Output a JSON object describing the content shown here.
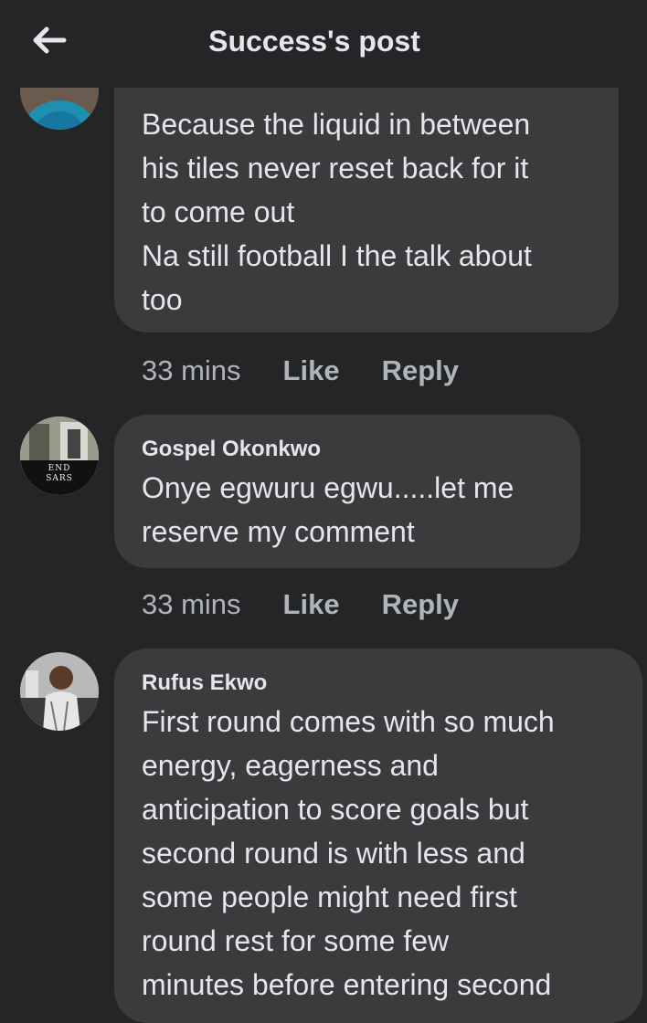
{
  "header": {
    "title": "Success's post"
  },
  "comments": [
    {
      "author": "",
      "text": "Because the liquid in between\nhis tiles never reset back for it\nto come out\nNa still football I the talk about\ntoo",
      "time": "33 mins",
      "like": "Like",
      "reply": "Reply"
    },
    {
      "author": "Gospel Okonkwo",
      "text": "Onye egwuru egwu.....let me\nreserve my comment",
      "time": "33 mins",
      "like": "Like",
      "reply": "Reply",
      "avatar_text": "END\nSARS"
    },
    {
      "author": "Rufus Ekwo",
      "text": "First round comes with so much\nenergy, eagerness and\nanticipation to score goals but\nsecond round is with less and\nsome people might need first\nround rest for some few\nminutes before entering second"
    }
  ]
}
